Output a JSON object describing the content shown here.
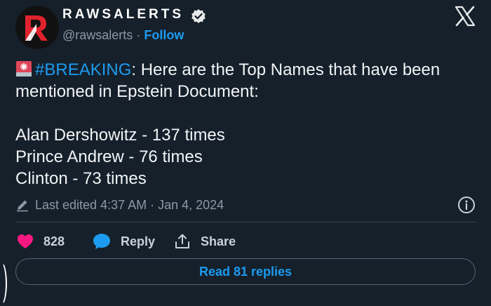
{
  "header": {
    "display_name": "RAWSALERTS",
    "handle": "@rawsalerts",
    "separator": "·",
    "follow_label": "Follow"
  },
  "tweet": {
    "hashtag": "#BREAKING",
    "text_line1": ": Here are the Top Names that have been",
    "text_line2": "mentioned in Epstein Document:",
    "names": [
      "Alan Dershowitz - 137 times",
      "Prince Andrew - 76 times",
      "Clinton - 73 times"
    ]
  },
  "meta": {
    "edited_label": "Last edited 4:37 AM · Jan 4, 2024"
  },
  "actions": {
    "like_count": "828",
    "reply_label": "Reply",
    "share_label": "Share"
  },
  "read_replies_label": "Read 81 replies",
  "colors": {
    "background": "#15202b",
    "accent": "#1d9bf0",
    "like": "#f91880",
    "muted": "#8b98a5"
  },
  "icons": [
    "rawsalerts-logo-icon",
    "verified-badge-icon",
    "x-logo-icon",
    "siren-icon",
    "pencil-icon",
    "info-icon",
    "heart-icon",
    "reply-bubble-icon",
    "share-icon"
  ]
}
